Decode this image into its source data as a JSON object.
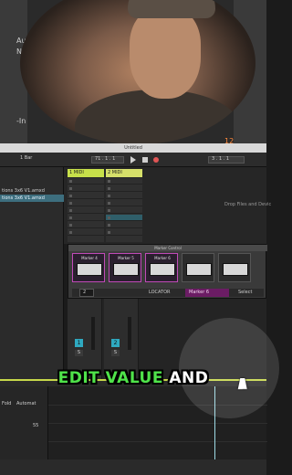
{
  "webcam": {
    "left_labels": [
      "Au",
      "Ni",
      "-In"
    ],
    "button_label": "",
    "corner_number": "12"
  },
  "window": {
    "title": "Untitled"
  },
  "transport": {
    "quantize": "1 Bar",
    "position": "71 . 1 . 1",
    "end_position": "3 . 1 . 1"
  },
  "browser": {
    "items": [
      {
        "label": "tions 3x6 V1.amxd",
        "selected": false
      },
      {
        "label": "tions 3x6 V1.amxd",
        "selected": true
      }
    ]
  },
  "session": {
    "tracks": [
      {
        "name": "1 MIDI",
        "color": "#c7e04a"
      },
      {
        "name": "2 MIDI",
        "color": "#d6e06a"
      }
    ],
    "drop_hint": "Drop Files and Devic"
  },
  "device": {
    "title": "Marker Control",
    "pads": [
      {
        "label": "Marker 4",
        "active": true
      },
      {
        "label": "Marker 5",
        "active": true
      },
      {
        "label": "Marker 6",
        "active": true
      },
      {
        "label": "",
        "active": false
      },
      {
        "label": "",
        "active": false
      },
      {
        "label": "",
        "active": false
      }
    ],
    "number_value": "2",
    "locator_label": "LOCATOR",
    "marker_value": "Marker 6",
    "right_button": "Select"
  },
  "mixer": {
    "strips": [
      {
        "number": "1",
        "solo": "S"
      },
      {
        "number": "2",
        "solo": "S"
      }
    ]
  },
  "editor": {
    "fold_label": "Fold",
    "automation_label": "Automat",
    "scale_value": "55"
  },
  "caption": {
    "highlight": "EDIT VALUE",
    "rest": " AND"
  },
  "colors": {
    "accent_magenta": "#c04ab7",
    "track_green": "#c7e04a",
    "caption_green": "#4fe34a",
    "mixer_blue": "#2fa9c0"
  }
}
